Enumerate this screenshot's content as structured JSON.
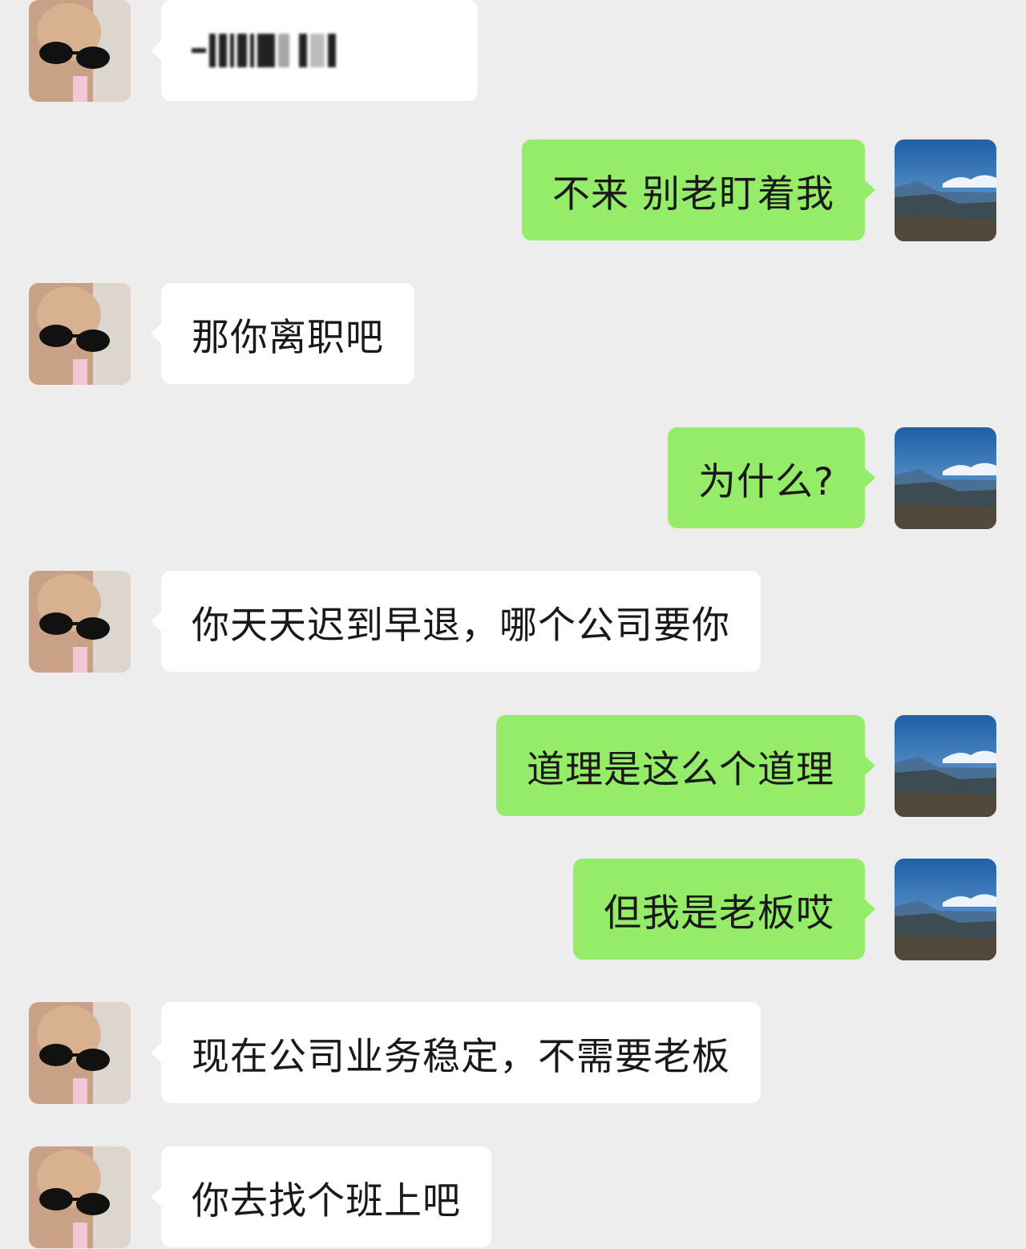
{
  "colors": {
    "background": "#ededed",
    "incoming_bubble": "#ffffff",
    "outgoing_bubble": "#95ec69",
    "text": "#191919"
  },
  "messages": [
    {
      "side": "left",
      "text": "",
      "redacted": true
    },
    {
      "side": "right",
      "text": "不来 别老盯着我"
    },
    {
      "side": "left",
      "text": "那你离职吧"
    },
    {
      "side": "right",
      "text": "为什么?"
    },
    {
      "side": "left",
      "text": "你天天迟到早退，哪个公司要你"
    },
    {
      "side": "right",
      "text": "道理是这么个道理"
    },
    {
      "side": "right",
      "text": "但我是老板哎"
    },
    {
      "side": "left",
      "text": "现在公司业务稳定，不需要老板"
    },
    {
      "side": "left",
      "text": "你去找个班上吧"
    }
  ]
}
